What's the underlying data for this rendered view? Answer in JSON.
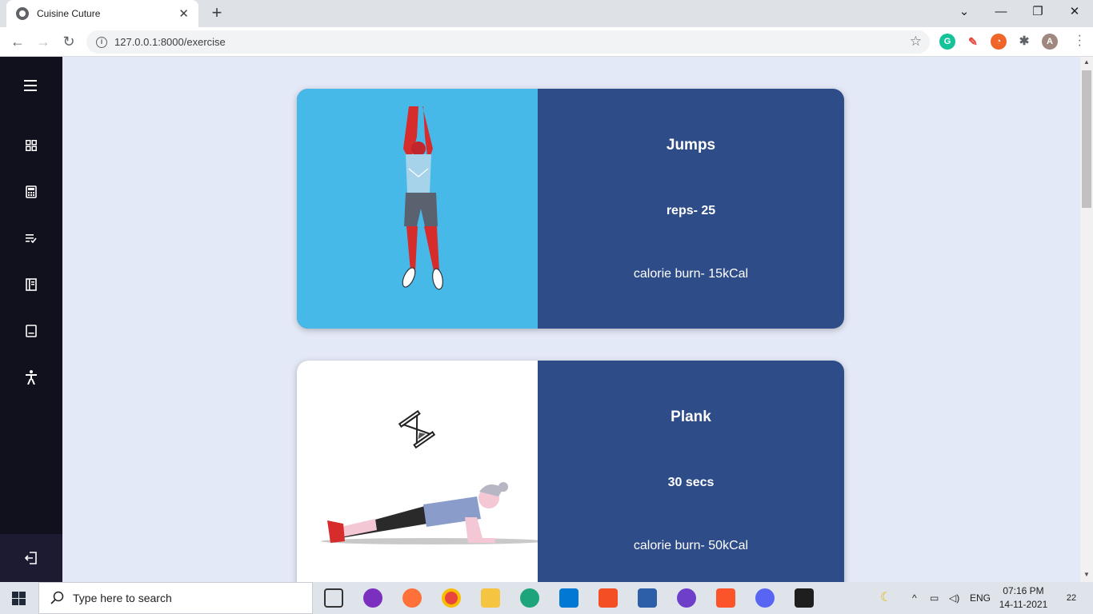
{
  "browser": {
    "tab_title": "Cuisine Cuture",
    "tab_close": "✕",
    "new_tab": "+",
    "url": "127.0.0.1:8000/exercise",
    "profile_initial": "A",
    "window_controls": [
      "minimize-icon",
      "restore-icon",
      "close-icon"
    ]
  },
  "sidebar": {
    "items": [
      "menu-icon",
      "dashboard-grid-icon",
      "calculator-icon",
      "playlist-check-icon",
      "book-icon",
      "notebook-icon",
      "accessibility-icon"
    ],
    "logout": "logout-icon",
    "background": "#11101d"
  },
  "exercises": [
    {
      "name": "Jumps",
      "detail": "reps- 25",
      "calories": "calorie burn- 15kCal",
      "image_bg": "#47b9e8"
    },
    {
      "name": "Plank",
      "detail": "30 secs",
      "calories": "calorie burn- 50kCal",
      "image_bg": "#ffffff"
    }
  ],
  "colors": {
    "page_bg": "#e4e9f7",
    "card_bg": "#2e4c88"
  },
  "taskbar": {
    "search_placeholder": "Type here to search",
    "language": "ENG",
    "time": "07:16 PM",
    "date": "14-11-2021",
    "notifications": "22"
  }
}
